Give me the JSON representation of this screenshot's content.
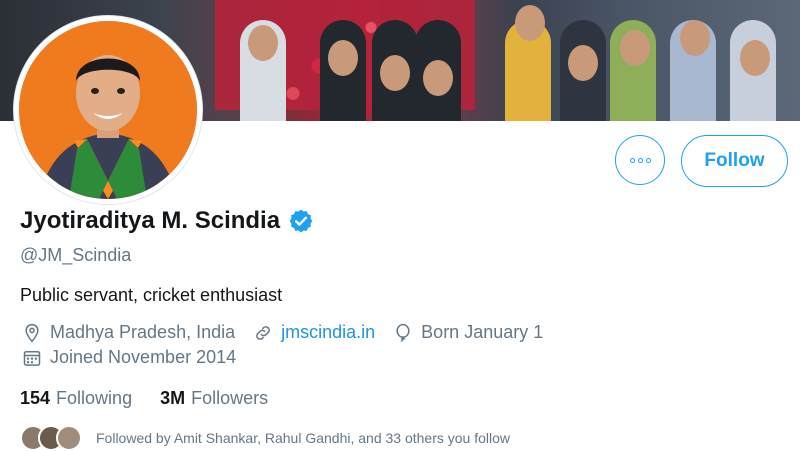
{
  "profile": {
    "name": "Jyotiraditya M. Scindia",
    "handle": "@JM_Scindia",
    "bio": "Public servant, cricket enthusiast",
    "location": "Madhya Pradesh, India",
    "website": "jmscindia.in",
    "birthday": "Born January 1",
    "joined": "Joined November 2014",
    "verified": true
  },
  "stats": {
    "following_count": "154",
    "following_label": "Following",
    "followers_count": "3M",
    "followers_label": "Followers"
  },
  "actions": {
    "follow_label": "Follow"
  },
  "followed_by": "Followed by Amit Shankar, Rahul Gandhi, and 33 others you follow",
  "colors": {
    "accent": "#1da1f2",
    "secondary_text": "#657786",
    "primary_text": "#14171a",
    "avatar_background": "#f07a1e"
  },
  "icons": [
    "location-icon",
    "link-icon",
    "balloon-icon",
    "calendar-icon",
    "verified-badge-icon",
    "more-options-icon"
  ]
}
